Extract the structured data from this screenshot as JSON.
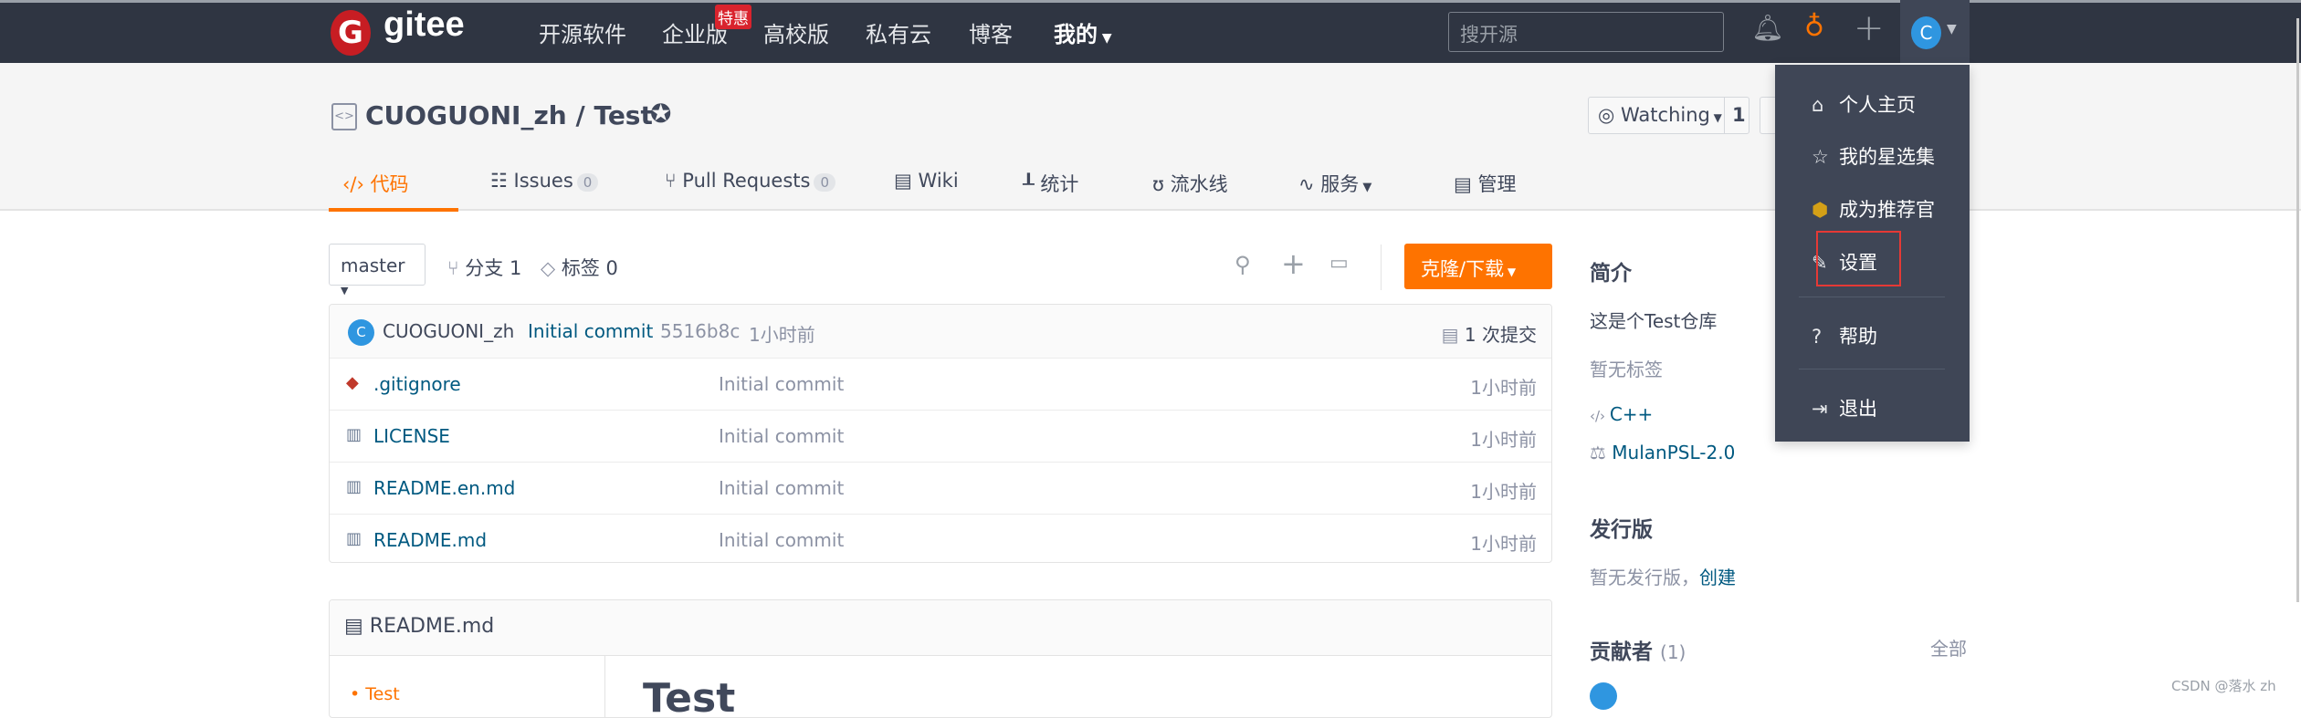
{
  "nav": {
    "logo": "gitee",
    "items": [
      "开源软件",
      "企业版",
      "高校版",
      "私有云",
      "博客",
      "我的"
    ],
    "badge": "特惠",
    "search_placeholder": "搜开源",
    "avatar_letter": "C"
  },
  "repo": {
    "owner": "CUOGUONI_zh",
    "name": "Test",
    "separator": " / ",
    "watch_label": "Watching",
    "watch_count": "1"
  },
  "tabs": [
    {
      "label": "代码",
      "active": true
    },
    {
      "label": "Issues",
      "count": "0"
    },
    {
      "label": "Pull Requests",
      "count": "0"
    },
    {
      "label": "Wiki"
    },
    {
      "label": "统计"
    },
    {
      "label": "流水线"
    },
    {
      "label": "服务"
    },
    {
      "label": "管理"
    }
  ],
  "branch": {
    "current": "master",
    "branches_label": "分支 1",
    "tags_label": "标签 0",
    "clone_label": "克隆/下载"
  },
  "commit": {
    "author": "CUOGUONI_zh",
    "message": "Initial commit",
    "hash": "5516b8c",
    "time": "1小时前",
    "count_label": "1 次提交"
  },
  "files": [
    {
      "name": ".gitignore",
      "message": "Initial commit",
      "time": "1小时前",
      "icon": "git-icon"
    },
    {
      "name": "LICENSE",
      "message": "Initial commit",
      "time": "1小时前",
      "icon": "book-icon"
    },
    {
      "name": "README.en.md",
      "message": "Initial commit",
      "time": "1小时前",
      "icon": "book-icon"
    },
    {
      "name": "README.md",
      "message": "Initial commit",
      "time": "1小时前",
      "icon": "book-icon"
    }
  ],
  "readme": {
    "title": "README.md",
    "toc_item": "Test",
    "heading": "Test"
  },
  "sidebar": {
    "intro_title": "简介",
    "description": "这是个Test仓库",
    "no_tags": "暂无标签",
    "language": "C++",
    "license": "MulanPSL-2.0",
    "release_title": "发行版",
    "no_release": "暂无发行版，",
    "create": "创建",
    "contributors_title": "贡献者",
    "contributors_count": "(1)",
    "all": "全部"
  },
  "dropdown": {
    "items": [
      "个人主页",
      "我的星选集",
      "成为推荐官",
      "设置",
      "帮助",
      "退出"
    ],
    "highlighted": "设置"
  },
  "watermark": "CSDN @落水 zh",
  "colors": {
    "accent": "#fe7300",
    "nav_bg": "#2f3542",
    "link": "#005980",
    "highlight_box": "#e53935"
  }
}
